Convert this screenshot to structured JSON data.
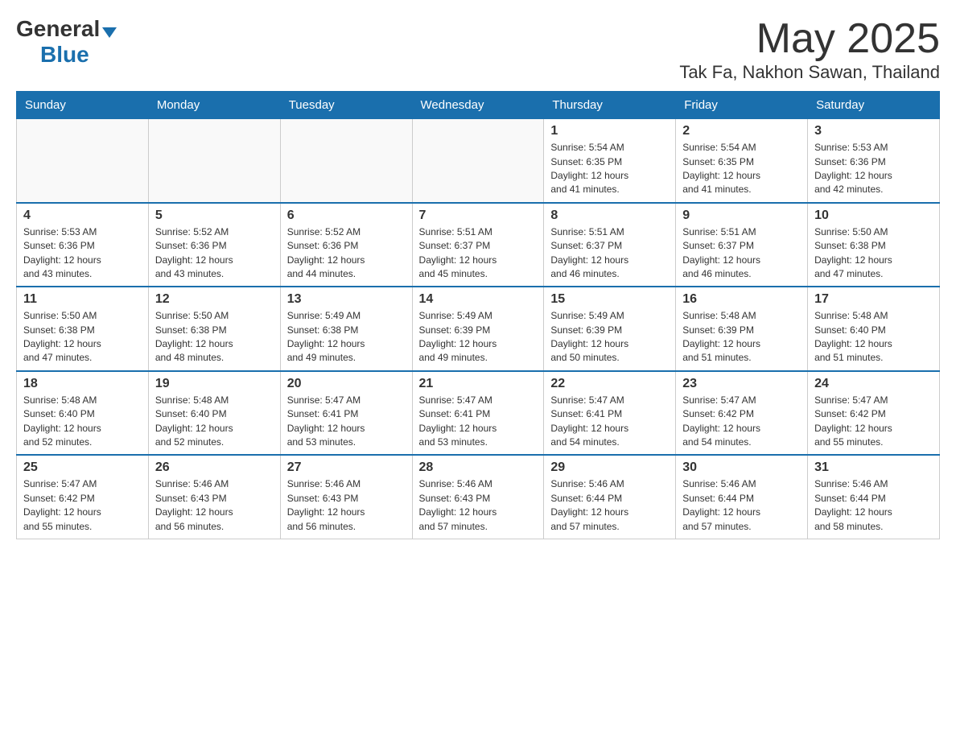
{
  "header": {
    "logo_general": "General",
    "logo_triangle": "▼",
    "logo_blue": "Blue",
    "month_title": "May 2025",
    "location": "Tak Fa, Nakhon Sawan, Thailand"
  },
  "days_of_week": [
    "Sunday",
    "Monday",
    "Tuesday",
    "Wednesday",
    "Thursday",
    "Friday",
    "Saturday"
  ],
  "weeks": [
    [
      {
        "day": "",
        "info": ""
      },
      {
        "day": "",
        "info": ""
      },
      {
        "day": "",
        "info": ""
      },
      {
        "day": "",
        "info": ""
      },
      {
        "day": "1",
        "info": "Sunrise: 5:54 AM\nSunset: 6:35 PM\nDaylight: 12 hours\nand 41 minutes."
      },
      {
        "day": "2",
        "info": "Sunrise: 5:54 AM\nSunset: 6:35 PM\nDaylight: 12 hours\nand 41 minutes."
      },
      {
        "day": "3",
        "info": "Sunrise: 5:53 AM\nSunset: 6:36 PM\nDaylight: 12 hours\nand 42 minutes."
      }
    ],
    [
      {
        "day": "4",
        "info": "Sunrise: 5:53 AM\nSunset: 6:36 PM\nDaylight: 12 hours\nand 43 minutes."
      },
      {
        "day": "5",
        "info": "Sunrise: 5:52 AM\nSunset: 6:36 PM\nDaylight: 12 hours\nand 43 minutes."
      },
      {
        "day": "6",
        "info": "Sunrise: 5:52 AM\nSunset: 6:36 PM\nDaylight: 12 hours\nand 44 minutes."
      },
      {
        "day": "7",
        "info": "Sunrise: 5:51 AM\nSunset: 6:37 PM\nDaylight: 12 hours\nand 45 minutes."
      },
      {
        "day": "8",
        "info": "Sunrise: 5:51 AM\nSunset: 6:37 PM\nDaylight: 12 hours\nand 46 minutes."
      },
      {
        "day": "9",
        "info": "Sunrise: 5:51 AM\nSunset: 6:37 PM\nDaylight: 12 hours\nand 46 minutes."
      },
      {
        "day": "10",
        "info": "Sunrise: 5:50 AM\nSunset: 6:38 PM\nDaylight: 12 hours\nand 47 minutes."
      }
    ],
    [
      {
        "day": "11",
        "info": "Sunrise: 5:50 AM\nSunset: 6:38 PM\nDaylight: 12 hours\nand 47 minutes."
      },
      {
        "day": "12",
        "info": "Sunrise: 5:50 AM\nSunset: 6:38 PM\nDaylight: 12 hours\nand 48 minutes."
      },
      {
        "day": "13",
        "info": "Sunrise: 5:49 AM\nSunset: 6:38 PM\nDaylight: 12 hours\nand 49 minutes."
      },
      {
        "day": "14",
        "info": "Sunrise: 5:49 AM\nSunset: 6:39 PM\nDaylight: 12 hours\nand 49 minutes."
      },
      {
        "day": "15",
        "info": "Sunrise: 5:49 AM\nSunset: 6:39 PM\nDaylight: 12 hours\nand 50 minutes."
      },
      {
        "day": "16",
        "info": "Sunrise: 5:48 AM\nSunset: 6:39 PM\nDaylight: 12 hours\nand 51 minutes."
      },
      {
        "day": "17",
        "info": "Sunrise: 5:48 AM\nSunset: 6:40 PM\nDaylight: 12 hours\nand 51 minutes."
      }
    ],
    [
      {
        "day": "18",
        "info": "Sunrise: 5:48 AM\nSunset: 6:40 PM\nDaylight: 12 hours\nand 52 minutes."
      },
      {
        "day": "19",
        "info": "Sunrise: 5:48 AM\nSunset: 6:40 PM\nDaylight: 12 hours\nand 52 minutes."
      },
      {
        "day": "20",
        "info": "Sunrise: 5:47 AM\nSunset: 6:41 PM\nDaylight: 12 hours\nand 53 minutes."
      },
      {
        "day": "21",
        "info": "Sunrise: 5:47 AM\nSunset: 6:41 PM\nDaylight: 12 hours\nand 53 minutes."
      },
      {
        "day": "22",
        "info": "Sunrise: 5:47 AM\nSunset: 6:41 PM\nDaylight: 12 hours\nand 54 minutes."
      },
      {
        "day": "23",
        "info": "Sunrise: 5:47 AM\nSunset: 6:42 PM\nDaylight: 12 hours\nand 54 minutes."
      },
      {
        "day": "24",
        "info": "Sunrise: 5:47 AM\nSunset: 6:42 PM\nDaylight: 12 hours\nand 55 minutes."
      }
    ],
    [
      {
        "day": "25",
        "info": "Sunrise: 5:47 AM\nSunset: 6:42 PM\nDaylight: 12 hours\nand 55 minutes."
      },
      {
        "day": "26",
        "info": "Sunrise: 5:46 AM\nSunset: 6:43 PM\nDaylight: 12 hours\nand 56 minutes."
      },
      {
        "day": "27",
        "info": "Sunrise: 5:46 AM\nSunset: 6:43 PM\nDaylight: 12 hours\nand 56 minutes."
      },
      {
        "day": "28",
        "info": "Sunrise: 5:46 AM\nSunset: 6:43 PM\nDaylight: 12 hours\nand 57 minutes."
      },
      {
        "day": "29",
        "info": "Sunrise: 5:46 AM\nSunset: 6:44 PM\nDaylight: 12 hours\nand 57 minutes."
      },
      {
        "day": "30",
        "info": "Sunrise: 5:46 AM\nSunset: 6:44 PM\nDaylight: 12 hours\nand 57 minutes."
      },
      {
        "day": "31",
        "info": "Sunrise: 5:46 AM\nSunset: 6:44 PM\nDaylight: 12 hours\nand 58 minutes."
      }
    ]
  ]
}
